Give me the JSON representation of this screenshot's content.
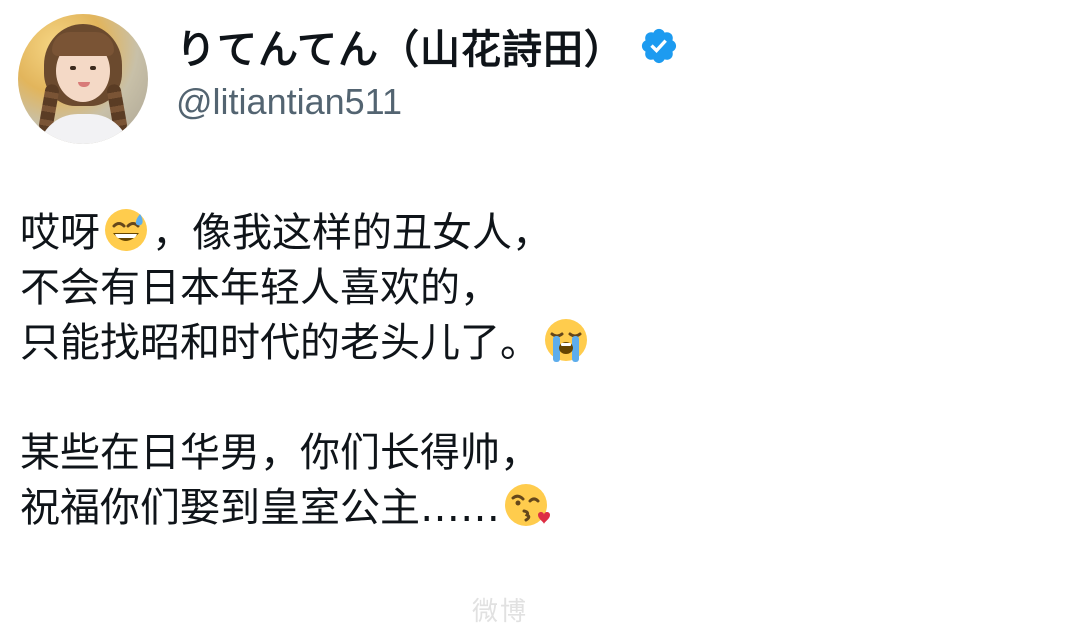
{
  "profile": {
    "display_name": "りてんてん（山花詩田）",
    "handle": "@litiantian511",
    "verified": true,
    "verified_color": "#1d9bf0"
  },
  "post": {
    "lines": [
      {
        "before": "哎呀",
        "emoji": "sweat-smile-emoji",
        "after": "，像我这样的丑女人，"
      },
      {
        "text": "不会有日本年轻人喜欢的，"
      },
      {
        "before": "只能找昭和时代的老头儿了。",
        "emoji": "loudly-crying-emoji",
        "after": ""
      },
      {
        "text": ""
      },
      {
        "text": "某些在日华男，你们长得帅，"
      },
      {
        "before": "祝福你们娶到皇室公主……",
        "emoji": "kissing-heart-emoji",
        "after": ""
      }
    ]
  },
  "watermark": {
    "text": "微博"
  },
  "colors": {
    "text": "#0f1419",
    "handle": "#536471",
    "emoji_face": "#ffcc4d"
  }
}
